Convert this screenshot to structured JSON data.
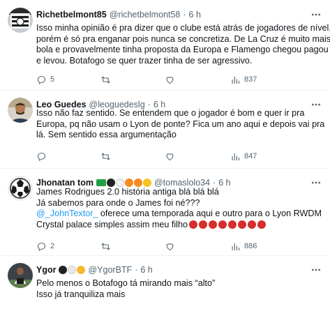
{
  "tweets": [
    {
      "name": "Richetbelmont85",
      "handle": "@richetbelmont58",
      "separator": "·",
      "time": "6 h",
      "lines": [
        "Isso minha opinião é pra dizer que o clube está atrás de jogadores de nível,",
        "porém é só pra enganar pois nunca se concretiza. De La Cruz é muito mais",
        "bola e provavelmente tinha proposta da Europa e Flamengo chegou pagou",
        "e levou. Botafogo se quer trazer tinha de ser agressivo."
      ],
      "replies": "5",
      "retweets": "",
      "likes": "",
      "views": "837"
    },
    {
      "name": "Leo Guedes",
      "handle": "@leoguedeslg",
      "separator": "·",
      "time": "6 h",
      "lines": [
        "Isso não faz sentido. Se entendem que o jogador é bom e quer ir pra",
        "Europa, pq não usam o Lyon de ponte? Fica um ano aqui e depois vai pra",
        "lá. Sem sentido essa argumentação"
      ],
      "replies": "",
      "retweets": "",
      "likes": "",
      "views": "847"
    },
    {
      "name": "Jhonatan tom",
      "handle": "@tomaslolo34",
      "separator": "·",
      "time": "6 h",
      "line1": "James Rodrigues 2.0 história antiga blá blá blá",
      "line2": "Já sabemos para onde o James foi né???",
      "mention": "@_JohnTextor_",
      "line3_rest": " oferece uma temporada aqui e  outro para o Lyon RWDM",
      "line4": "Crystal palace simples assim meu filho",
      "replies": "2",
      "retweets": "",
      "likes": "",
      "views": "886"
    },
    {
      "name": "Ygor",
      "handle": "@YgorBTF",
      "separator": "·",
      "time": "6 h",
      "lines": [
        "Pelo menos o Botafogo tá mirando mais “alto”",
        "Isso já tranquiliza mais"
      ]
    }
  ],
  "colors": {
    "text": "#0f1419",
    "secondary": "#536471",
    "link": "#1d9bf0",
    "divider": "#eff3f4"
  },
  "icons": [
    "more-icon",
    "reply-icon",
    "retweet-icon",
    "like-icon",
    "views-icon"
  ]
}
